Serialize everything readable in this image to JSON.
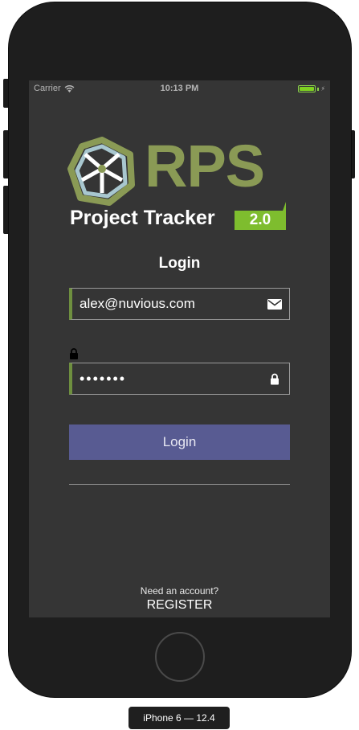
{
  "status_bar": {
    "carrier": "Carrier",
    "time": "10:13 PM",
    "battery_color": "#7ed321"
  },
  "logo": {
    "letters": "RPS",
    "subtitle": "Project Tracker",
    "version": "2.0",
    "brand_color": "#8a9a55",
    "version_color": "#7ebd2e"
  },
  "login": {
    "title": "Login",
    "email_value": "alex@nuvious.com",
    "email_icon": "envelope-icon",
    "password_value": "•••••••",
    "password_icon": "lock-icon",
    "button_label": "Login",
    "button_color": "#585b92"
  },
  "footer": {
    "need_account": "Need an account?",
    "register_label": "REGISTER"
  },
  "device": {
    "label": "iPhone 6 — 12.4"
  }
}
